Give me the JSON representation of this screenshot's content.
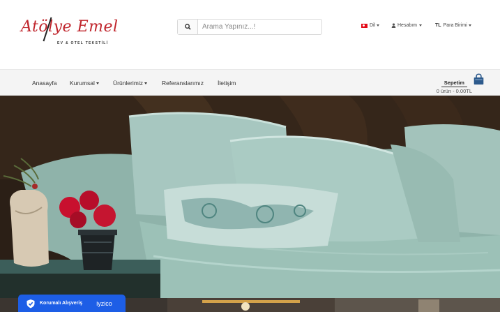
{
  "brand": {
    "name": "Atölye Emel",
    "tagline": "EV & OTEL TEKSTİLİ",
    "color": "#c0262d"
  },
  "search": {
    "placeholder": "Arama Yapınız...!",
    "value": ""
  },
  "top_links": {
    "language": "Dil",
    "account": "Hesabım",
    "currency_code": "TL",
    "currency": "Para Birimi"
  },
  "nav": {
    "items": [
      "Anasayfa",
      "Kurumsal",
      "Ürünlerimiz",
      "Referanslarımız",
      "İletişim"
    ]
  },
  "cart": {
    "title": "Sepetim",
    "summary": "0 ürün - 0.00TL",
    "accent": "#2d5a8c"
  },
  "secure_badge": {
    "label": "Korumalı Alışveriş",
    "provider": "iyzico",
    "color": "#1d5ee6"
  }
}
